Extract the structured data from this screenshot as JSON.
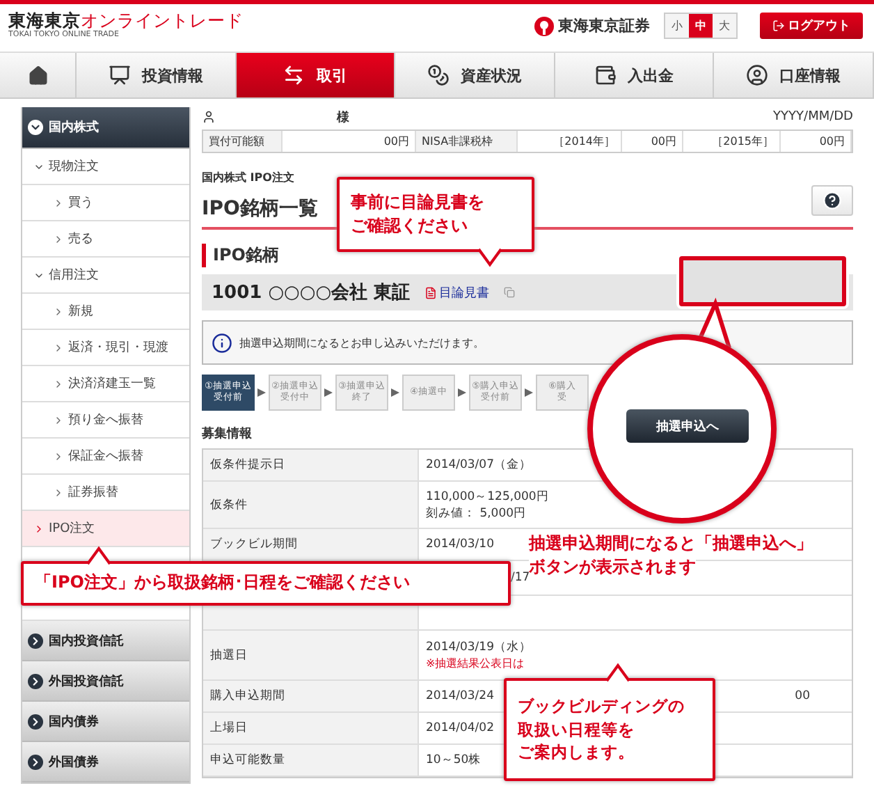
{
  "header": {
    "logo_main": "東海東京",
    "logo_accent": "オンライントレード",
    "logo_sub": "TOKAI TOKYO ONLINE TRADE",
    "brand": "東海東京証券",
    "logout": "ログアウト",
    "font_sizes": [
      {
        "label": "小",
        "selected": false
      },
      {
        "label": "中",
        "selected": true
      },
      {
        "label": "大",
        "selected": false
      }
    ]
  },
  "nav": [
    {
      "kind": "home",
      "selected": false
    },
    {
      "kind": "tab",
      "label": "投資情報",
      "selected": false
    },
    {
      "kind": "tab",
      "label": "取引",
      "selected": true
    },
    {
      "kind": "tab",
      "label": "資産状況",
      "selected": false
    },
    {
      "kind": "tab",
      "label": "入出金",
      "selected": false
    },
    {
      "kind": "tab",
      "label": "口座情報",
      "selected": false
    }
  ],
  "sidebar": [
    {
      "label": "国内株式",
      "expanded": true,
      "children": [
        {
          "label": "現物注文",
          "expanded": true,
          "children": [
            {
              "label": "買う",
              "selected": false
            },
            {
              "label": "売る",
              "selected": false
            }
          ]
        },
        {
          "label": "信用注文",
          "expanded": true,
          "children": [
            {
              "label": "新規",
              "selected": false
            },
            {
              "label": "返済・現引・現渡",
              "selected": false
            },
            {
              "label": "決済済建玉一覧",
              "selected": false
            },
            {
              "label": "預り金へ振替",
              "selected": false
            },
            {
              "label": "保証金へ振替",
              "selected": false
            },
            {
              "label": "証券振替",
              "selected": false
            }
          ]
        },
        {
          "label": "IPO注文",
          "selected": true
        }
      ]
    },
    {
      "label": "国内投資信託",
      "expanded": false
    },
    {
      "label": "外国投資信託",
      "expanded": false
    },
    {
      "label": "国内債券",
      "expanded": false
    },
    {
      "label": "外国債券",
      "expanded": false
    }
  ],
  "account": {
    "suffix": "様",
    "date": "YYYY/MM/DD",
    "balance": [
      {
        "kind": "label",
        "text": "買付可能額"
      },
      {
        "kind": "value",
        "text": "00円"
      },
      {
        "kind": "label",
        "text": "NISA非課税枠"
      },
      {
        "kind": "value",
        "text": "［2014年］"
      },
      {
        "kind": "value",
        "text": "00円"
      },
      {
        "kind": "value",
        "text": "［2015年］"
      },
      {
        "kind": "value",
        "text": "00円"
      }
    ]
  },
  "page": {
    "breadcrumb": "国内株式 IPO注文",
    "title": "IPO銘柄一覧"
  },
  "ipo": {
    "heading": "IPO銘柄",
    "stock": "1001 ○○○○会社 東証",
    "prospectus": "目論見書",
    "notice": "抽選申込期間になるとお申し込みいただけます。",
    "steps": [
      {
        "lines": [
          "①抽選申込",
          "受付前"
        ],
        "selected": true
      },
      {
        "lines": [
          "②抽選申込",
          "受付中"
        ],
        "selected": false
      },
      {
        "lines": [
          "③抽選申込",
          "終了"
        ],
        "selected": false
      },
      {
        "lines": [
          "④抽選中"
        ],
        "selected": false
      },
      {
        "lines": [
          "⑤購入申込",
          "受付前"
        ],
        "selected": false
      },
      {
        "lines": [
          "⑥購入",
          "受"
        ],
        "selected": false
      }
    ],
    "recruit_heading": "募集情報",
    "rows": [
      {
        "label": "仮条件提示日",
        "values": [
          "2014/03/07（金）"
        ]
      },
      {
        "label": "仮条件",
        "values": [
          "110,000～125,000円",
          "刻み値： 5,000円"
        ]
      },
      {
        "label": "ブックビル期間",
        "values": [
          "2014/03/10"
        ]
      },
      {
        "values": [
          "/17"
        ],
        "kind": "covered"
      },
      {
        "values": [],
        "kind": "covered"
      },
      {
        "label": "抽選日",
        "values": [
          "2014/03/19（水）"
        ],
        "note": "※抽選結果公表日は"
      },
      {
        "label": "購入申込期間",
        "values": [
          "2014/03/24"
        ],
        "tail": "00"
      },
      {
        "label": "上場日",
        "values": [
          "2014/04/02"
        ]
      },
      {
        "label": "申込可能数量",
        "values": [
          "10～50株"
        ]
      }
    ]
  },
  "callouts": [
    {
      "kind": "box",
      "lines": [
        "事前に目論見書を",
        "ご確認ください"
      ]
    },
    {
      "kind": "circle",
      "button": "抽選申込へ"
    },
    {
      "kind": "note",
      "lines": [
        "抽選申込期間になると「抽選申込へ」",
        "ボタンが表示されます"
      ]
    },
    {
      "kind": "box",
      "lines": [
        "「IPO注文」から取扱銘柄･日程をご確認ください"
      ]
    },
    {
      "kind": "box",
      "lines": [
        "ブックビルディングの",
        "取扱い日程等を",
        "ご案内します。"
      ]
    }
  ]
}
